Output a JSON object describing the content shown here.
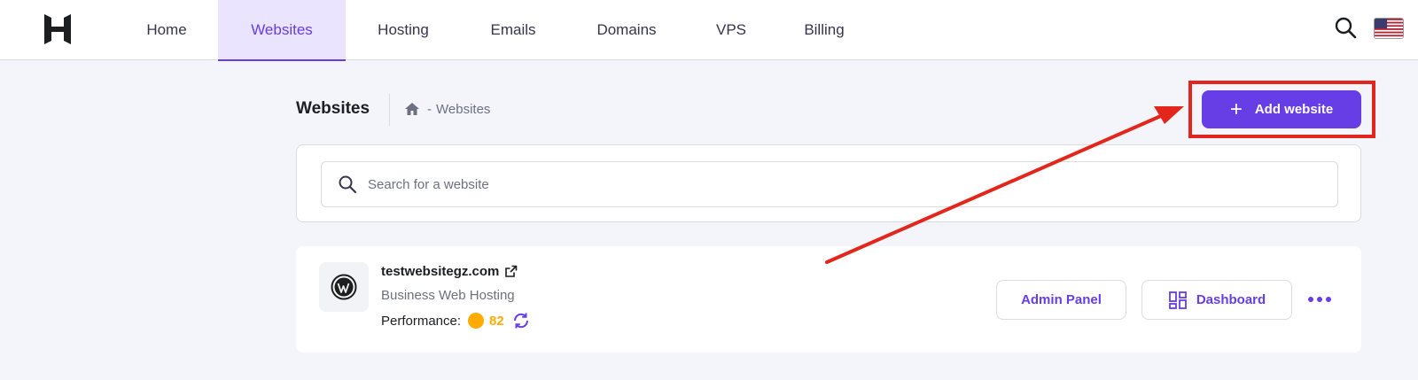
{
  "nav": {
    "items": [
      {
        "label": "Home"
      },
      {
        "label": "Websites",
        "active": true
      },
      {
        "label": "Hosting"
      },
      {
        "label": "Emails"
      },
      {
        "label": "Domains"
      },
      {
        "label": "VPS"
      },
      {
        "label": "Billing"
      }
    ],
    "icons": {
      "logo": "hostinger-logo-icon",
      "search": "search-icon",
      "language": "us-flag-icon"
    }
  },
  "header": {
    "title": "Websites",
    "breadcrumb": {
      "home_icon": "home-icon",
      "separator": "-",
      "current": "Websites"
    },
    "add_button_label": "Add website"
  },
  "search": {
    "placeholder": "Search for a website",
    "value": ""
  },
  "website": {
    "domain": "testwebsitegz.com",
    "plan": "Business Web Hosting",
    "performance_label": "Performance:",
    "performance_score": "82",
    "platform_icon": "wordpress-icon",
    "admin_panel_label": "Admin Panel",
    "dashboard_label": "Dashboard"
  },
  "colors": {
    "accent": "#673de6",
    "highlight": "#e3261b",
    "score": "#ffab00",
    "background": "#f4f4fb"
  }
}
